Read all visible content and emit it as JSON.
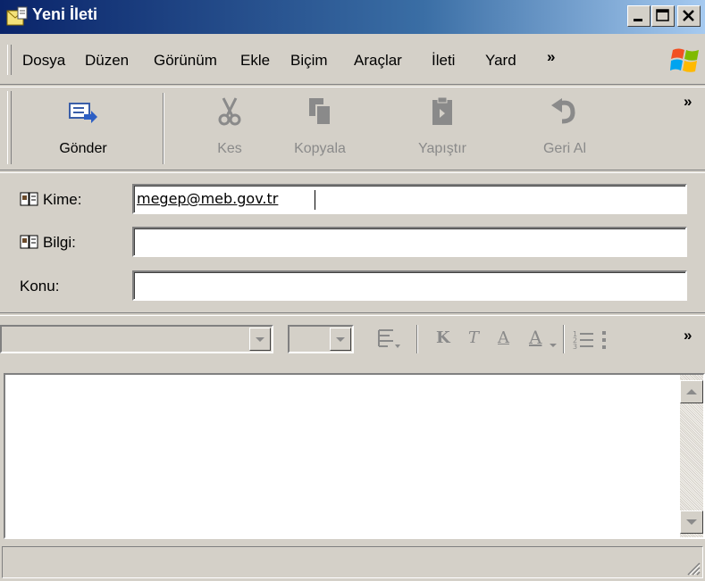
{
  "window": {
    "title": "Yeni İleti"
  },
  "menu": {
    "items": [
      "Dosya",
      "Düzen",
      "Görünüm",
      "Ekle",
      "Biçim",
      "Araçlar",
      "İleti",
      "Yard"
    ],
    "overflow": "»"
  },
  "toolbar": {
    "buttons": [
      {
        "label": "Gönder",
        "icon": "send-icon",
        "enabled": true
      },
      {
        "label": "Kes",
        "icon": "scissors-icon",
        "enabled": false
      },
      {
        "label": "Kopyala",
        "icon": "copy-icon",
        "enabled": false
      },
      {
        "label": "Yapıştır",
        "icon": "paste-icon",
        "enabled": false
      },
      {
        "label": "Geri Al",
        "icon": "undo-icon",
        "enabled": false
      }
    ],
    "overflow": "»"
  },
  "header": {
    "to": {
      "label": "Kime:",
      "value": "megep@meb.gov.tr"
    },
    "cc": {
      "label": "Bilgi:",
      "value": ""
    },
    "subject": {
      "label": "Konu:",
      "value": ""
    }
  },
  "format": {
    "bold": "K",
    "italic": "T",
    "underline": "A",
    "font_color": "A",
    "overflow": "»"
  },
  "colors": {
    "title_gradient_start": "#0a246a",
    "title_gradient_end": "#a6caf0",
    "chrome": "#d4d0c8",
    "disabled_text": "#8a8a8a"
  }
}
